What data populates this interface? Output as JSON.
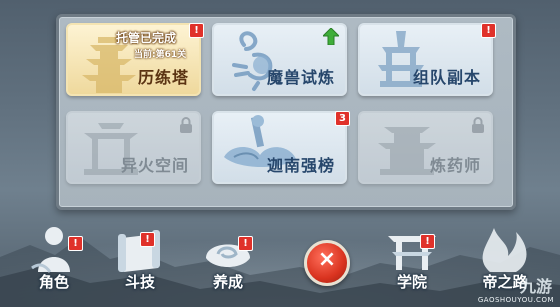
{
  "tiles": [
    {
      "name": "历练塔",
      "status_line1": "托管已完成",
      "status_line2": "当前:第61关",
      "badge": "!"
    },
    {
      "name": "魔兽试炼",
      "badge": "up-arrow"
    },
    {
      "name": "组队副本",
      "badge": "!"
    },
    {
      "name": "异火空间",
      "badge": "lock-icon"
    },
    {
      "name": "迦南强榜",
      "badge": "3"
    },
    {
      "name": "炼药师",
      "badge": "lock-icon"
    }
  ],
  "nav": [
    {
      "label": "角色",
      "badge": "!"
    },
    {
      "label": "斗技",
      "badge": "!"
    },
    {
      "label": "养成",
      "badge": "!"
    },
    {
      "label": "学院",
      "badge": "!"
    },
    {
      "label": "帝之路",
      "badge": ""
    }
  ],
  "close_symbol": "×",
  "watermark": {
    "logo": "九游",
    "site": "GAOSHOUYOU.COM"
  },
  "colors": {
    "alert": "#e0312a",
    "title_blue": "#27476c",
    "title_brown": "#5a3312",
    "up_arrow": "#3fae3a"
  }
}
